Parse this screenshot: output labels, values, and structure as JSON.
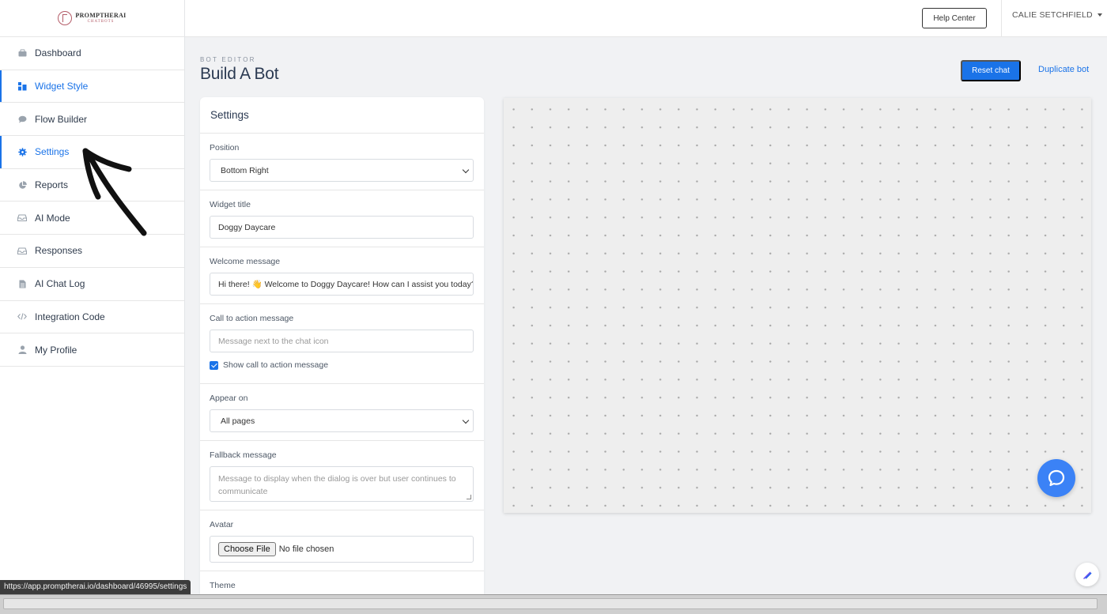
{
  "logo": {
    "name": "PROMPTHERAI",
    "sub": "CHATBOTS"
  },
  "sidebar": {
    "items": [
      {
        "label": "Dashboard",
        "icon": "dashboard-icon"
      },
      {
        "label": "Widget Style",
        "icon": "widget-icon"
      },
      {
        "label": "Flow Builder",
        "icon": "chat-bubble-icon"
      },
      {
        "label": "Settings",
        "icon": "gear-icon"
      },
      {
        "label": "Reports",
        "icon": "pie-chart-icon"
      },
      {
        "label": "AI Mode",
        "icon": "inbox-icon"
      },
      {
        "label": "Responses",
        "icon": "inbox-icon"
      },
      {
        "label": "AI Chat Log",
        "icon": "document-icon"
      },
      {
        "label": "Integration Code",
        "icon": "code-icon"
      },
      {
        "label": "My Profile",
        "icon": "user-icon"
      }
    ],
    "active": [
      "Widget Style",
      "Settings"
    ]
  },
  "topbar": {
    "help_label": "Help Center",
    "user_name": "CALIE SETCHFIELD"
  },
  "header": {
    "eyebrow": "BOT EDITOR",
    "title": "Build A Bot",
    "reset_label": "Reset chat",
    "duplicate_label": "Duplicate bot"
  },
  "settings": {
    "title": "Settings",
    "position": {
      "label": "Position",
      "value": "Bottom Right"
    },
    "widget_title": {
      "label": "Widget title",
      "value": "Doggy Daycare"
    },
    "welcome": {
      "label": "Welcome message",
      "value": "Hi there! 👋 Welcome to Doggy Daycare! How can I assist you today?"
    },
    "cta": {
      "label": "Call to action message",
      "placeholder": "Message next to the chat icon",
      "checkbox_label": "Show call to action message",
      "checked": true
    },
    "appear_on": {
      "label": "Appear on",
      "value": "All pages"
    },
    "fallback": {
      "label": "Fallback message",
      "placeholder": "Message to display when the dialog is over but user continues to communicate"
    },
    "avatar": {
      "label": "Avatar",
      "button_label": "Choose File",
      "status": "No file chosen"
    },
    "theme": {
      "label": "Theme"
    }
  },
  "status_bar": {
    "url": "https://app.promptherai.io/dashboard/46995/settings"
  },
  "colors": {
    "accent": "#1a73e8",
    "fab": "#3b82f6",
    "sidebar_bg": "#ffffff",
    "page_bg": "#f1f2f4"
  }
}
